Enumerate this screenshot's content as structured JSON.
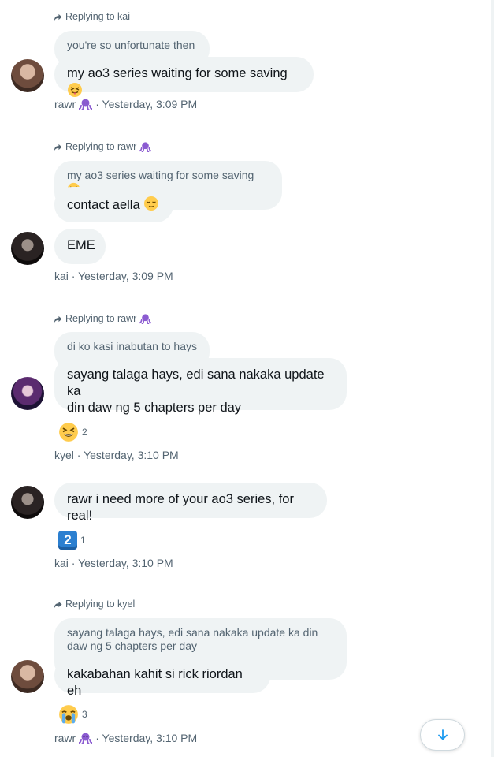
{
  "messages": [
    {
      "reply_to": "Replying to kai",
      "quote": "you're so unfortunate then",
      "text": "my ao3 series waiting for some saving",
      "meta": "rawr",
      "time": "· Yesterday, 3:09 PM"
    },
    {
      "reply_to": "Replying to rawr",
      "quote": "my ao3 series waiting for some saving",
      "text": "contact aella",
      "text2": "EME",
      "meta": "kai · Yesterday, 3:09 PM"
    },
    {
      "reply_to": "Replying to rawr",
      "quote": "di ko kasi inabutan to hays",
      "text_line1": "sayang talaga hays, edi sana nakaka update ka",
      "text_line2": "din daw ng 5 chapters per day",
      "reaction_count": "2",
      "meta": "kyel · Yesterday, 3:10 PM"
    },
    {
      "text": "rawr i need more of your ao3 series, for real!",
      "reaction_emoji": "2",
      "reaction_count": "1",
      "meta": "kai · Yesterday, 3:10 PM"
    },
    {
      "reply_to": "Replying to kyel",
      "quote_line1": "sayang talaga hays, edi sana nakaka update ka din",
      "quote_line2": "daw ng 5 chapters per day",
      "text": "kakabahan kahit si rick riordan eh",
      "reaction_count": "3",
      "meta": "rawr",
      "time": "· Yesterday, 3:10 PM"
    }
  ],
  "icons": {
    "reply": "reply-arrow-icon",
    "octopus": "octopus-emoji-icon",
    "scroll_down": "arrow-down-icon"
  },
  "colors": {
    "accent": "#1d9bf0",
    "bubble": "#eff3f4",
    "secondary_text": "#536471",
    "octopus": "#8b5bd1"
  }
}
